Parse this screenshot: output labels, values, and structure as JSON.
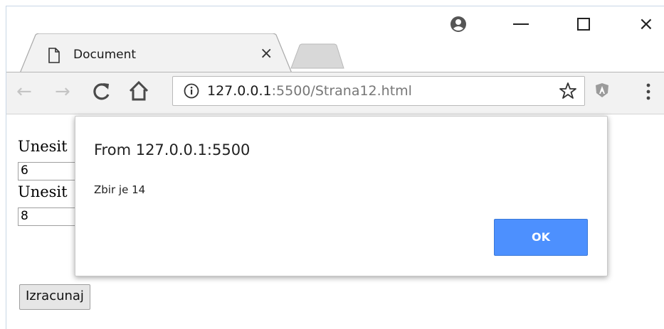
{
  "browser": {
    "tab_title": "Document",
    "tab_close": "×",
    "url_host": "127.0.0.1",
    "url_rest": ":5500/Strana12.html",
    "close_glyph": "×"
  },
  "page": {
    "label1": "Unesit",
    "value1": "6",
    "label2": "Unesit",
    "value2": "8",
    "button_label": "Izracunaj"
  },
  "dialog": {
    "title": "From 127.0.0.1:5500",
    "message": "Zbir je 14",
    "ok_label": "OK"
  }
}
